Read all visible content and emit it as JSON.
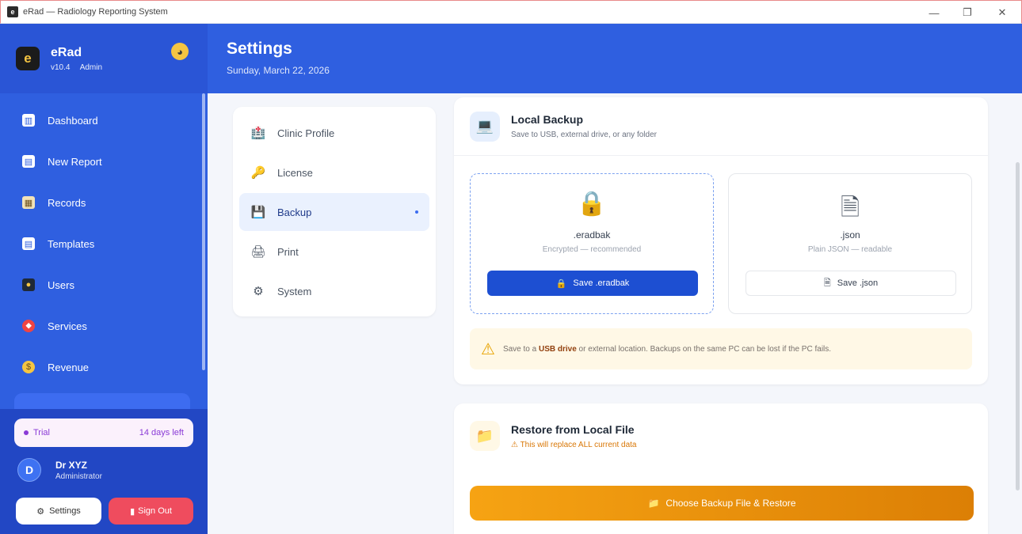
{
  "window": {
    "title": "eRad — Radiology Reporting System",
    "controls": {
      "minimize": "—",
      "maximize": "❐",
      "close": "✕"
    }
  },
  "brand": {
    "name": "eRad",
    "version": "v10.4",
    "role": "Admin",
    "logo_letter": "e",
    "badge_icon": "palette-icon"
  },
  "sidebar": {
    "items": [
      {
        "label": "Dashboard",
        "icon": "chart-icon",
        "glyph": "▥",
        "color": "#ffffff"
      },
      {
        "label": "New Report",
        "icon": "document-icon",
        "glyph": "▤",
        "color": "#ffffff"
      },
      {
        "label": "Records",
        "icon": "clipboard-icon",
        "glyph": "▦",
        "color": "#f2e2b8"
      },
      {
        "label": "Templates",
        "icon": "page-icon",
        "glyph": "▤",
        "color": "#ffffff"
      },
      {
        "label": "Users",
        "icon": "users-icon",
        "glyph": "◼",
        "color": "#1f2937"
      },
      {
        "label": "Services",
        "icon": "pill-icon",
        "glyph": "◆",
        "color": "#ef4444"
      },
      {
        "label": "Revenue",
        "icon": "moneybag-icon",
        "glyph": "●",
        "color": "#f5c542"
      }
    ]
  },
  "footer": {
    "trial_label": "Trial",
    "trial_days": "14 days left",
    "user_initial": "D",
    "user_name": "Dr XYZ",
    "user_role": "Administrator",
    "settings_label": "Settings",
    "signout_label": "Sign Out"
  },
  "header": {
    "title": "Settings",
    "date": "Sunday, March 22, 2026"
  },
  "settings_menu": {
    "items": [
      {
        "label": "Clinic Profile",
        "icon": "hospital-icon",
        "glyph": "🏥"
      },
      {
        "label": "License",
        "icon": "key-icon",
        "glyph": "🔑"
      },
      {
        "label": "Backup",
        "icon": "floppy-icon",
        "glyph": "💾"
      },
      {
        "label": "Print",
        "icon": "printer-icon",
        "glyph": "🖨"
      },
      {
        "label": "System",
        "icon": "gear-icon",
        "glyph": "⚙"
      }
    ],
    "active_index": 2
  },
  "local_backup": {
    "title": "Local Backup",
    "subtitle": "Save to USB, external drive, or any folder",
    "icon": "laptop-icon",
    "eradbak": {
      "name": ".eradbak",
      "desc": "Encrypted — recommended",
      "button": "Save .eradbak",
      "icon": "lock-icon"
    },
    "json": {
      "name": ".json",
      "desc": "Plain JSON — readable",
      "button": "Save .json",
      "icon": "file-icon"
    },
    "warning_pre": "Save to a ",
    "warning_bold": "USB drive",
    "warning_post": " or external location. Backups on the same PC can be lost if the PC fails."
  },
  "restore": {
    "title": "Restore from Local File",
    "subtitle": "This will replace ALL current data",
    "button": "Choose Backup File & Restore",
    "icon": "folder-icon"
  },
  "colors": {
    "primary": "#2f5fe0",
    "accent_button": "#1d4fd2",
    "warning_bg": "#fff8e6",
    "restore_orange": "#f6a313",
    "signout_red": "#ef4c5e",
    "trial_purple": "#8a3ad6"
  }
}
